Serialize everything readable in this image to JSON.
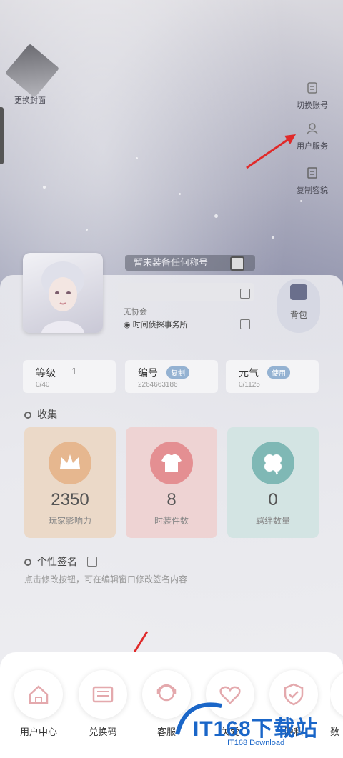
{
  "top": {
    "change_cover": "更换封面",
    "switch_account": "切换账号",
    "user_service": "用户服务",
    "copy_info": "复制容貌"
  },
  "profile": {
    "nickname": "暂未装备任何称号",
    "association": "无协会",
    "studio": "时间侦探事务所",
    "bag_label": "背包"
  },
  "stats": [
    {
      "title": "等级",
      "value": "1",
      "sub": "0/40"
    },
    {
      "title": "编号",
      "badge": "复制",
      "sub": "2264663186"
    },
    {
      "title": "元气",
      "badge": "使用",
      "sub": "0/1125"
    }
  ],
  "collection": {
    "title": "收集",
    "items": [
      {
        "value": "2350",
        "label": "玩家影响力",
        "color": "#e6b78f",
        "icon": "crown-icon"
      },
      {
        "value": "8",
        "label": "时装件数",
        "color": "#e48f92",
        "icon": "shirt-icon"
      },
      {
        "value": "0",
        "label": "羁绊数量",
        "color": "#7fb8b5",
        "icon": "clover-icon"
      }
    ]
  },
  "signature": {
    "title": "个性签名",
    "hint": "点击修改按钮，可在编辑窗口修改签名内容"
  },
  "bottom_bar": [
    {
      "label": "用户中心",
      "icon": "home-icon"
    },
    {
      "label": "兑换码",
      "icon": "ticket-icon"
    },
    {
      "label": "客服",
      "icon": "headset-icon"
    },
    {
      "label": "关爱",
      "icon": "heart-plus-icon"
    },
    {
      "label": "隐私",
      "icon": "shield-check-icon"
    },
    {
      "label": "数",
      "icon": "more-icon"
    }
  ],
  "watermark": {
    "main": "IT168下载站",
    "sub": "IT168 Download"
  }
}
